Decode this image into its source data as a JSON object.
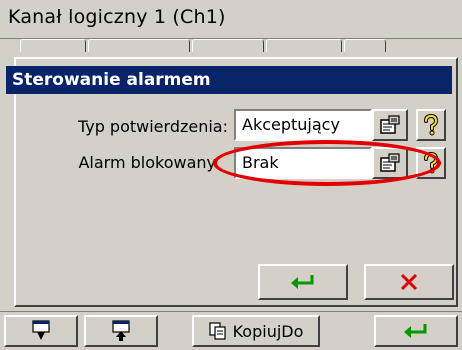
{
  "window": {
    "title": "Kanał logiczny 1 (Ch1)"
  },
  "dialog": {
    "title": "Sterowanie alarmem",
    "fields": [
      {
        "label": "Typ potwierdzenia:",
        "value": "Akceptujący"
      },
      {
        "label": "Alarm blokowany",
        "value": "Brak"
      }
    ],
    "ok_icon": "enter-arrow-icon",
    "cancel_icon": "red-x-icon"
  },
  "toolbar": {
    "copy_label": "KopiujDo",
    "buttons": [
      "import-icon",
      "export-icon",
      "copy-icon",
      "enter-arrow-icon"
    ]
  },
  "colors": {
    "header_blue": "#0a246a",
    "highlight_red": "#e30000",
    "ok_green": "#009a00",
    "cancel_red": "#e00000"
  }
}
